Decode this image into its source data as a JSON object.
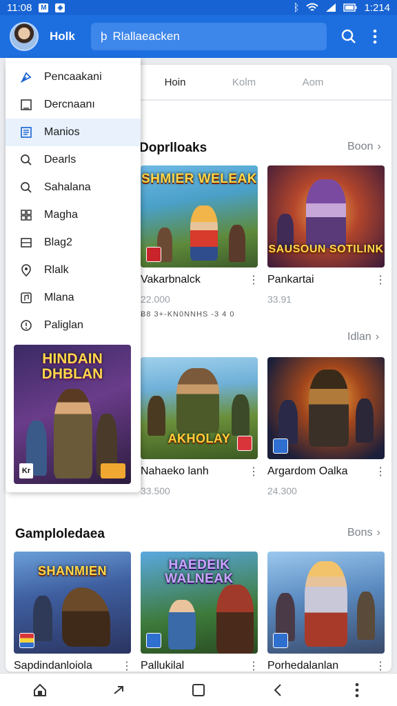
{
  "status_bar": {
    "time": "11:08",
    "right_time": "1:214"
  },
  "app_bar": {
    "brand": "Holk",
    "search_text": "Rlallaeacken"
  },
  "drawer": {
    "items": [
      {
        "label": "Pencaakani",
        "icon": "pin-icon"
      },
      {
        "label": "Dercnaanı",
        "icon": "square-icon"
      },
      {
        "label": "Manios",
        "icon": "list-icon",
        "active": true
      },
      {
        "label": "Dearls",
        "icon": "search-icon"
      },
      {
        "label": "Sahalana",
        "icon": "search-icon"
      },
      {
        "label": "Magha",
        "icon": "grid-icon"
      },
      {
        "label": "Blag2",
        "icon": "panel-icon"
      },
      {
        "label": "Rlalk",
        "icon": "location-icon"
      },
      {
        "label": "Mlana",
        "icon": "music-icon"
      },
      {
        "label": "Paliglan",
        "icon": "info-icon"
      }
    ],
    "promo_title": "HINDAIN DHBLAN",
    "promo_badge": "Kr"
  },
  "tabs": [
    {
      "label": "Hoin",
      "active": true
    },
    {
      "label": "Kolm",
      "active": false
    },
    {
      "label": "Aom",
      "active": false
    }
  ],
  "sections": [
    {
      "title": "Doprlloaks",
      "more": "Boon"
    },
    {
      "title": "",
      "more": "Idlan"
    },
    {
      "title": "Gamploledaea",
      "more": "Bons"
    }
  ],
  "strip_text": "Ƀ8 3+-KN0NNHS -3 4 0",
  "cards": [
    {
      "art_title": "SHMIER WELEAK",
      "name": "Vakarbnalck",
      "meta": "22.000"
    },
    {
      "art_title": "SAUSOUN SOTILINK",
      "name": "Pankartai",
      "meta": "33.91"
    },
    {
      "art_title": "AKHOLAY",
      "name": "Nahaeko lanh",
      "meta": "33.500"
    },
    {
      "art_title": "",
      "name": "Argardom Oalka",
      "meta": "24.300"
    },
    {
      "art_title": "SHANMIEN",
      "name": "Sapdindanloiola",
      "meta": ""
    },
    {
      "art_title": "HAEDEIK WALNEAK",
      "name": "Pallukilal",
      "meta": ""
    },
    {
      "art_title": "",
      "name": "Porhedalanlan",
      "meta": ""
    }
  ],
  "colors": {
    "primary": "#1d6fe0",
    "status": "#1763d3",
    "drawer_active": "#e8f1fc"
  }
}
